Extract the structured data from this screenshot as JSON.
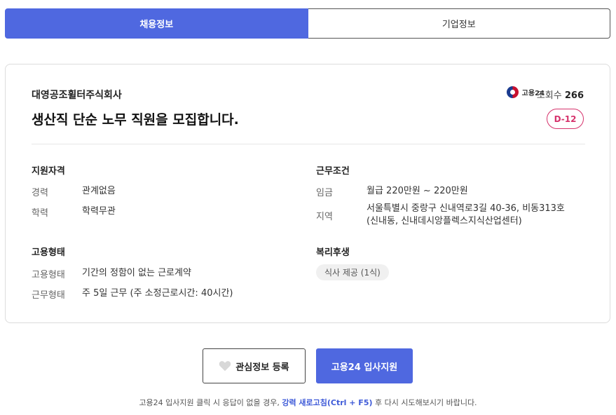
{
  "tabs": {
    "job_info": "채용정보",
    "company_info": "기업정보"
  },
  "header": {
    "company": "대영공조휠터주식회사",
    "title": "생산직 단순 노무 직원을 모집합니다.",
    "source": "고용24",
    "views_label": "조회수",
    "views_count": "266",
    "dday": "D-12"
  },
  "qualifications": {
    "heading": "지원자격",
    "career_label": "경력",
    "career_value": "관계없음",
    "education_label": "학력",
    "education_value": "학력무관"
  },
  "conditions": {
    "heading": "근무조건",
    "wage_label": "임금",
    "wage_value": "월급 220만원 ~ 220만원",
    "location_label": "지역",
    "location_line1": "서울특별시 중랑구 신내역로3길 40-36, 비동313호",
    "location_line2": "(신내동, 신내데시앙플렉스지식산업센터)"
  },
  "employment": {
    "heading": "고용형태",
    "type_label": "고용형태",
    "type_value": "기간의 정함이 없는 근로계약",
    "hours_label": "근무형태",
    "hours_value": "주 5일 근무 (주 소정근로시간: 40시간)"
  },
  "benefits": {
    "heading": "복리후생",
    "items": [
      "식사 제공 (1식)"
    ]
  },
  "actions": {
    "favorite_label": "관심정보 등록",
    "apply_label": "고용24 입사지원"
  },
  "footnote": {
    "before": "고용24 입사지원 클릭 시 응답이 없을 경우, ",
    "highlight": "강력 새로고침(Ctrl + F5)",
    "after": " 후 다시 시도해보시기 바랍니다."
  },
  "colors": {
    "primary": "#4f68e0",
    "dday": "#d6336c"
  }
}
